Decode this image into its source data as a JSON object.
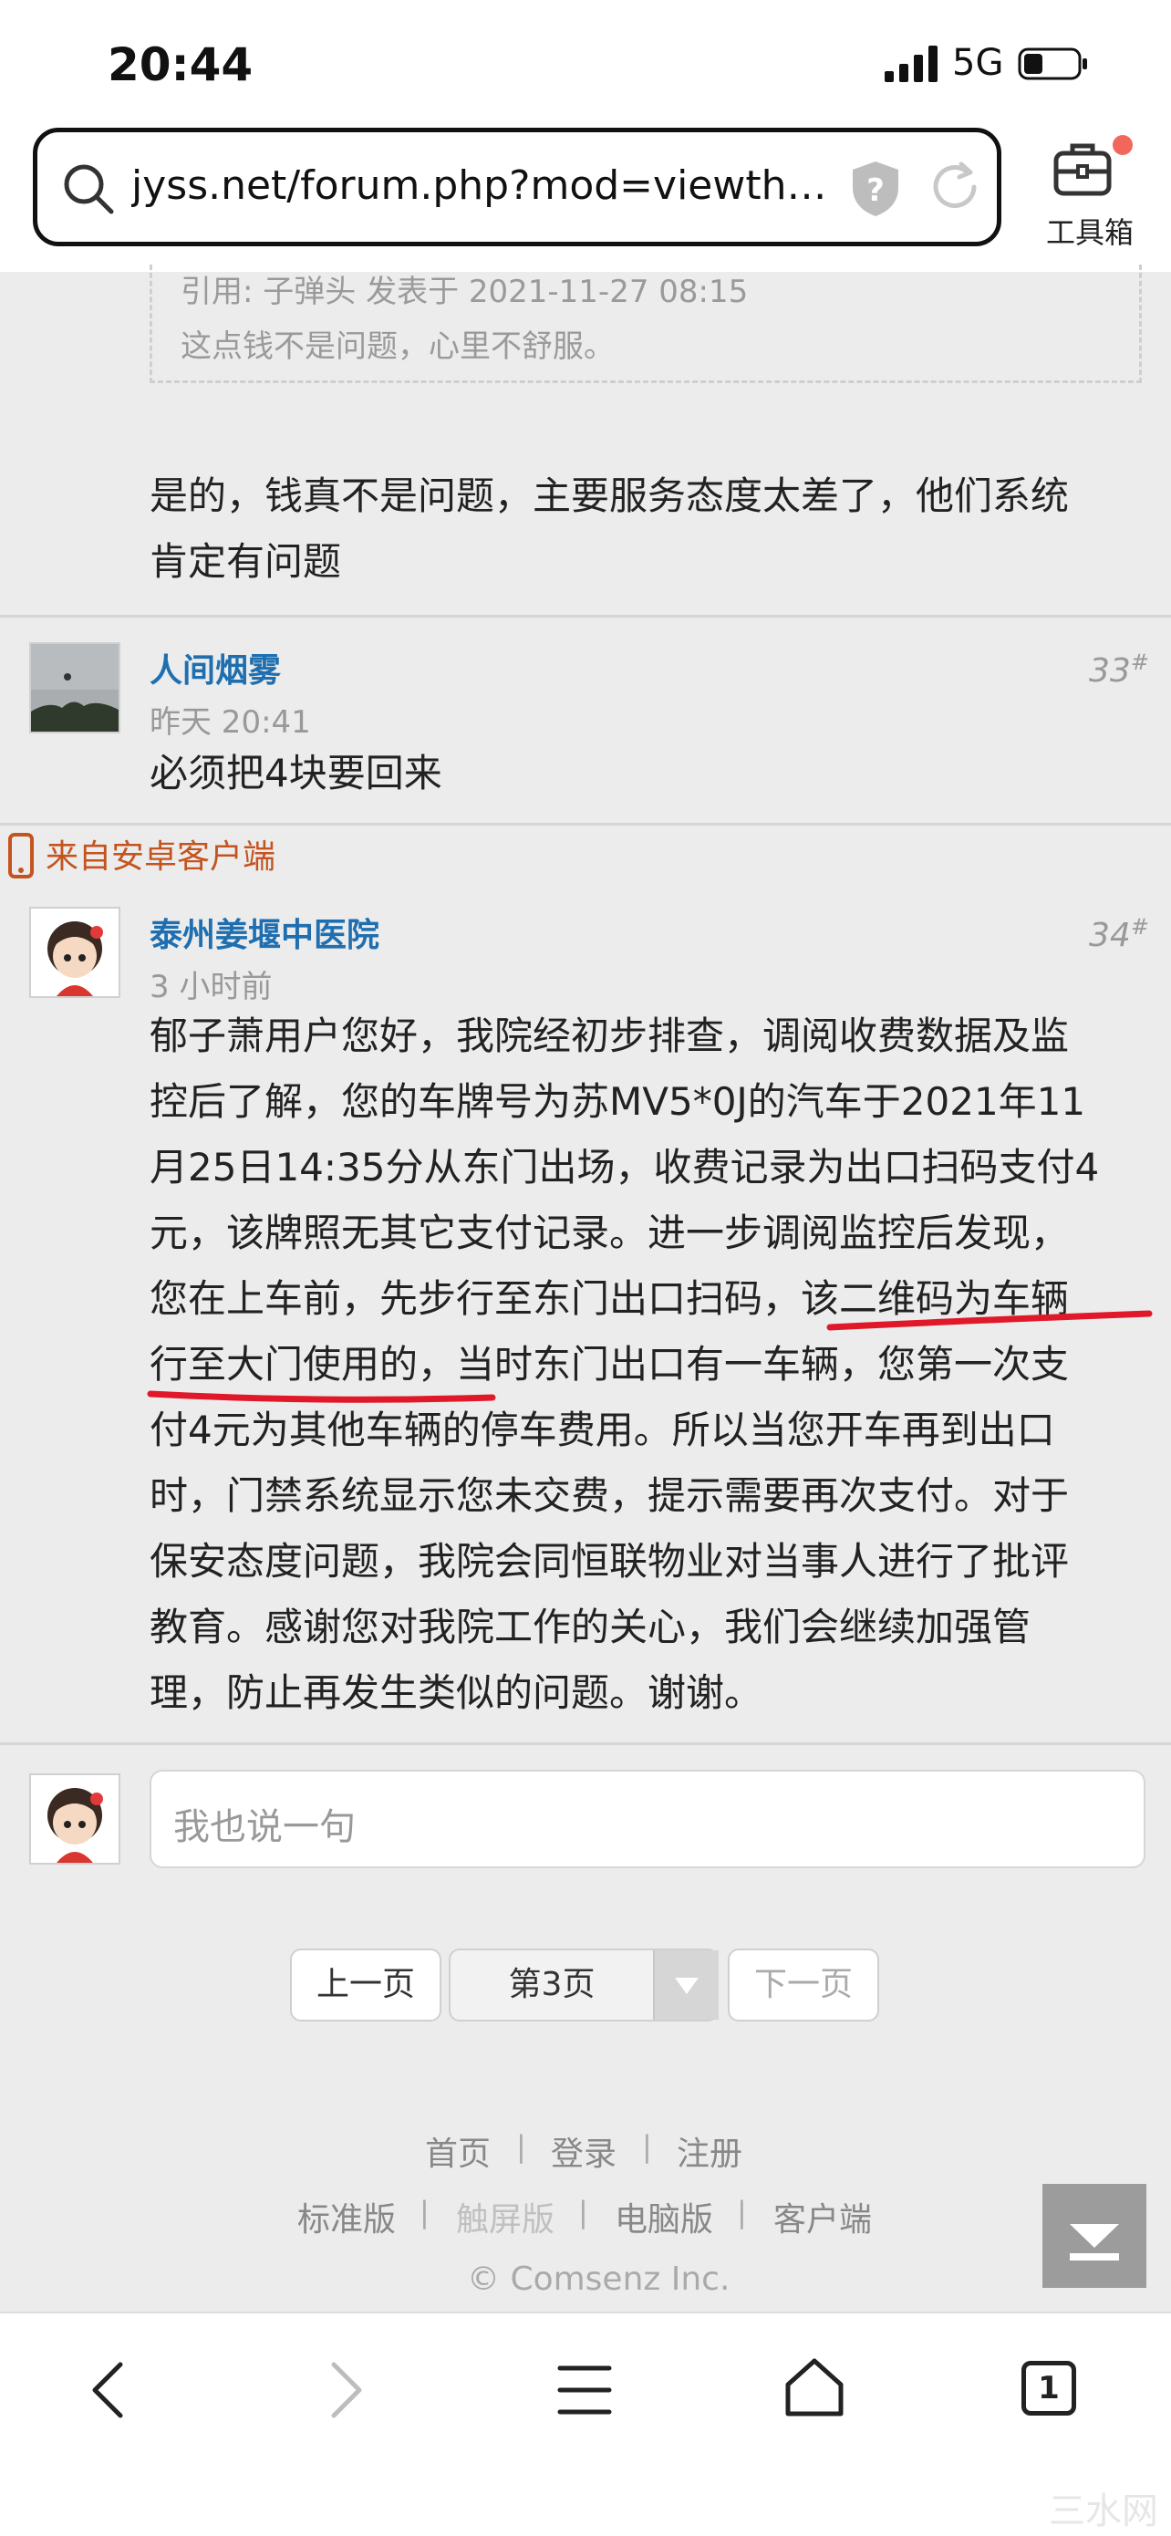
{
  "status_bar": {
    "time": "20:44",
    "network": "5G"
  },
  "address_bar": {
    "url": "jyss.net/forum.php?mod=viewthread&...",
    "toolbox_label": "工具箱"
  },
  "quote": {
    "meta": "引用: 子弹头 发表于 2021-11-27 08:15",
    "text": "这点钱不是问题，心里不舒服。"
  },
  "posts": [
    {
      "text_lines": [
        "是的，钱真不是问题，主要服务态度太差了，他们系统",
        "肯定有问题"
      ]
    },
    {
      "username": "人间烟雾",
      "time": "昨天 20:41",
      "floor": "33",
      "text_lines": [
        "必须把4块要回来"
      ],
      "client": "来自安卓客户端"
    },
    {
      "username": "泰州姜堰中医院",
      "time": "3 小时前",
      "floor": "34",
      "text_lines": [
        "郁子萧用户您好，我院经初步排查，调阅收费数据及监",
        "控后了解，您的车牌号为苏MV5*0J的汽车于2021年11",
        "月25日14:35分从东门出场，收费记录为出口扫码支付4",
        "元，该牌照无其它支付记录。进一步调阅监控后发现，",
        "您在上车前，先步行至东门出口扫码，该二维码为车辆",
        "行至大门使用的，当时东门出口有一车辆，您第一次支",
        "付4元为其他车辆的停车费用。所以当您开车再到出口",
        "时，门禁系统显示您未交费，提示需要再次支付。对于",
        "保安态度问题，我院会同恒联物业对当事人进行了批评",
        "教育。感谢您对我院工作的关心，我们会继续加强管",
        "理，防止再发生类似的问题。谢谢。"
      ]
    }
  ],
  "reply": {
    "placeholder": "我也说一句"
  },
  "pagination": {
    "prev": "上一页",
    "current": "第3页",
    "next": "下一页"
  },
  "footer": {
    "row1": [
      "首页",
      "登录",
      "注册"
    ],
    "row2": [
      "标准版",
      "触屏版",
      "电脑版",
      "客户端"
    ],
    "copyright": "© Comsenz Inc."
  },
  "bottom_nav": {
    "tab_count": "1"
  },
  "watermark": "三水网",
  "colors": {
    "link": "#1f6fb0",
    "client": "#c4541f",
    "underline": "#e0192a"
  }
}
